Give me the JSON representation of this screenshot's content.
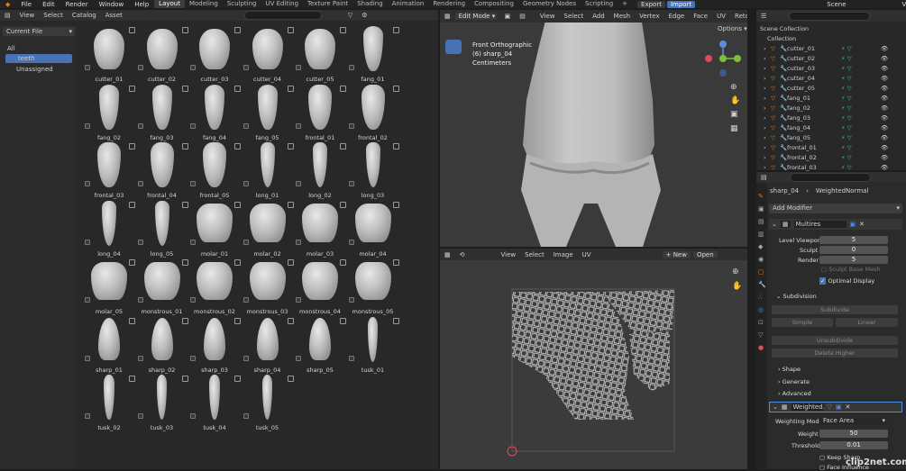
{
  "topbar": {
    "menus": [
      "File",
      "Edit",
      "Render",
      "Window",
      "Help"
    ],
    "workspaces": [
      "Layout",
      "Modeling",
      "Sculpting",
      "UV Editing",
      "Texture Paint",
      "Shading",
      "Animation",
      "Rendering",
      "Compositing",
      "Geometry Nodes",
      "Scripting"
    ],
    "plus": "+",
    "export": "Export",
    "import": "Import",
    "scene": "Scene",
    "viewlayer": "ViewLayer"
  },
  "asset": {
    "menus": [
      "View",
      "Select",
      "Catalog",
      "Asset"
    ],
    "library": "Current File",
    "catalogs": [
      "All",
      "teeth",
      "Unassigned"
    ],
    "items": [
      "cutter_01",
      "cutter_02",
      "cutter_03",
      "cutter_04",
      "cutter_05",
      "fang_01",
      "fang_02",
      "fang_03",
      "fang_04",
      "fang_05",
      "frontal_01",
      "frontal_02",
      "frontal_03",
      "frontal_04",
      "frontal_05",
      "long_01",
      "long_02",
      "long_03",
      "long_04",
      "long_05",
      "molar_01",
      "molar_02",
      "molar_03",
      "molar_04",
      "molar_05",
      "monstrous_01",
      "monstrous_02",
      "monstrous_03",
      "monstrous_04",
      "monstrous_05",
      "sharp_01",
      "sharp_02",
      "sharp_03",
      "sharp_04",
      "sharp_05",
      "tusk_01",
      "tusk_02",
      "tusk_03",
      "tusk_04",
      "tusk_05"
    ]
  },
  "viewport": {
    "mode": "Edit Mode",
    "menus": [
      "View",
      "Select",
      "Add",
      "Mesh",
      "Vertex",
      "Edge",
      "Face",
      "UV"
    ],
    "retopo": "RetopoFlo",
    "options": "Options",
    "info1": "Front Orthographic",
    "info2": "(6) sharp_04",
    "info3": "Centimeters"
  },
  "uv": {
    "menus": [
      "View",
      "Select",
      "Image",
      "UV"
    ],
    "new": "New",
    "open": "Open"
  },
  "outliner": {
    "root": "Scene Collection",
    "collection": "Collection",
    "items": [
      "cutter_01",
      "cutter_02",
      "cutter_03",
      "cutter_04",
      "cutter_05",
      "fang_01",
      "fang_02",
      "fang_03",
      "fang_04",
      "fang_05",
      "frontal_01",
      "frontal_02",
      "frontal_03"
    ]
  },
  "props": {
    "object": "sharp_04",
    "modifier": "WeightedNormal",
    "add_modifier": "Add Modifier",
    "multires": "Multires",
    "level_viewport_label": "Level Viewport",
    "level_viewport": "5",
    "sculpt_label": "Sculpt",
    "sculpt": "0",
    "render_label": "Render",
    "render": "5",
    "sculpt_base_mesh": "Sculpt Base Mesh",
    "optimal_display": "Optimal Display",
    "subdivision": "Subdivision",
    "subdivide": "Subdivide",
    "simple": "Simple",
    "linear": "Linear",
    "unsubdivide": "Unsubdivide",
    "delete_higher": "Delete Higher",
    "shape": "Shape",
    "generate": "Generate",
    "advanced": "Advanced",
    "weighted": "Weighted...",
    "weighting_mode_label": "Weighting Mode",
    "weighting_mode": "Face Area",
    "weight_label": "Weight",
    "weight": "50",
    "threshold_label": "Threshold",
    "threshold": "0.01",
    "keep_sharp": "Keep Sharp",
    "face_infl": "Face Influence"
  },
  "watermark": "clip2net.com"
}
